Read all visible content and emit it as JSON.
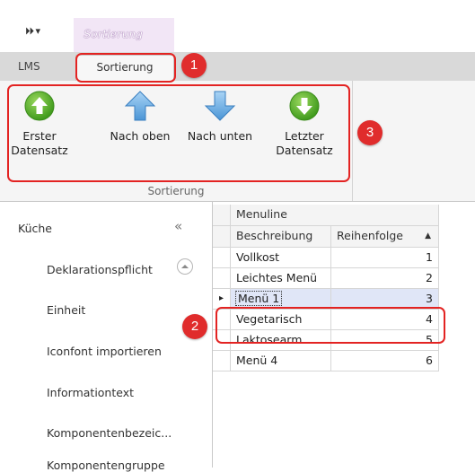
{
  "quick_access": {
    "glyph": "⏵⏵ ▾"
  },
  "contextual_tab": {
    "label": "Sortierung"
  },
  "ribbon_tabs": [
    {
      "label": "LMS"
    },
    {
      "label": "Sortierung",
      "active": true
    }
  ],
  "ribbon": {
    "group_label": "Sortierung",
    "buttons": [
      {
        "label_line1": "Erster",
        "label_line2": "Datensatz",
        "icon": "green-circle-arrow-up-icon"
      },
      {
        "label_line1": "Nach oben",
        "label_line2": "",
        "icon": "blue-arrow-up-icon"
      },
      {
        "label_line1": "Nach unten",
        "label_line2": "",
        "icon": "blue-arrow-down-icon"
      },
      {
        "label_line1": "Letzter",
        "label_line2": "Datensatz",
        "icon": "green-circle-arrow-down-icon"
      }
    ]
  },
  "callouts": [
    "1",
    "2",
    "3"
  ],
  "nav": {
    "title": "Küche",
    "collapse_glyph": "«",
    "items": [
      "Deklarationspflicht",
      "Einheit",
      "Iconfont importieren",
      "Informationtext",
      "Komponentenbezeic...",
      "Komponentengruppe"
    ]
  },
  "grid": {
    "group_header": "Menuline",
    "columns": [
      "Beschreibung",
      "Reihenfolge"
    ],
    "sort_glyph": "▲",
    "selected_indicator": "▸",
    "rows": [
      {
        "beschreibung": "Vollkost",
        "reihenfolge": "1"
      },
      {
        "beschreibung": "Leichtes Menü",
        "reihenfolge": "2"
      },
      {
        "beschreibung": "Menü 1",
        "reihenfolge": "3",
        "selected": true
      },
      {
        "beschreibung": "Vegetarisch",
        "reihenfolge": "4"
      },
      {
        "beschreibung": "Laktosearm",
        "reihenfolge": "5"
      },
      {
        "beschreibung": "Menü 4",
        "reihenfolge": "6"
      }
    ]
  },
  "colors": {
    "callout_red": "#e32322",
    "ribbon_bg": "#f5f5f5",
    "selection_bg": "#e0e6f7",
    "green_icon": "#5aae2b",
    "blue_icon": "#6aaee6"
  }
}
